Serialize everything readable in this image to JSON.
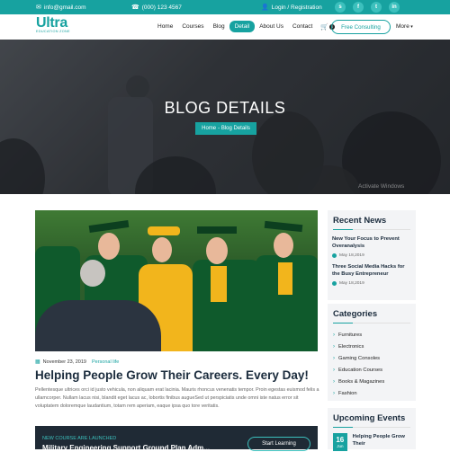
{
  "topbar": {
    "email": "info@gmail.com",
    "phone": "(000) 123 4567",
    "login": "Login / Registration",
    "socials": [
      "skype-icon",
      "facebook-icon",
      "twitter-icon",
      "linkedin-icon"
    ]
  },
  "nav": {
    "logo_main": "Ultra",
    "logo_tagline": "EDUCATION ZONE",
    "items": [
      "Home",
      "Courses",
      "Blog",
      "Detail",
      "About Us",
      "Contact"
    ],
    "cart_count": "0",
    "cta": "Free Consulting",
    "more": "More"
  },
  "hero": {
    "title": "BLOG DETAILS",
    "breadcrumb_home": "Home",
    "breadcrumb_current": "- Blog Details",
    "watermark": "Activate Windows"
  },
  "post": {
    "date": "November 23, 2019",
    "category": "Personal life",
    "title": "Helping People Grow Their Careers. Every Day!",
    "body": "Pellentesque ultrices orci id justo vehicula, non aliquam erat lacinia. Mauris rhoncus venenatis tempor. Proin egestas euismod felis a ullamcorper. Nullam lacus nisi, blandit eget lacus ac, lobortis finibus augueSed ut perspiciatis unde omni iste natus error sit voluptatem doloremque laudantium, totam rem aperiam, eaque ipsa quo tore veritatis."
  },
  "cta": {
    "label": "NEW COURSE ARE LAUNCHED",
    "title": "Military Engineering Support Ground Plan Adm...",
    "button": "Start Learning"
  },
  "sidebar": {
    "recent_title": "Recent News",
    "news": [
      {
        "title": "New Your Focus to Prevent Overanalysis",
        "date": "May 18,2019"
      },
      {
        "title": "Three Social Media Hacks for the Busy Entrepreneur",
        "date": "May 18,2019"
      }
    ],
    "categories_title": "Categories",
    "categories": [
      "Furnitures",
      "Electronics",
      "Gaming Consoles",
      "Education Courses",
      "Books & Magazines",
      "Fashion"
    ],
    "events_title": "Upcoming Events",
    "event": {
      "day": "16",
      "month": "Jun",
      "title": "Helping People Grow Their"
    }
  },
  "colors": {
    "accent": "#17a2a0",
    "dark": "#1f2a35"
  }
}
